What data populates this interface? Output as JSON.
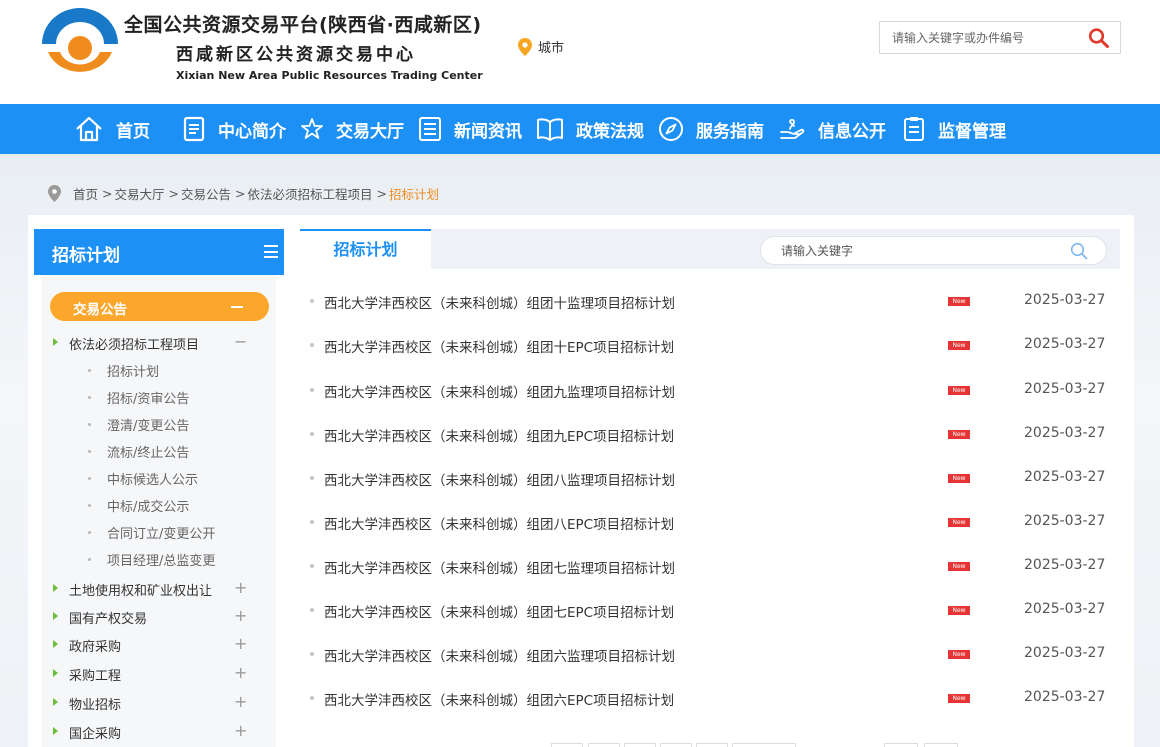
{
  "header": {
    "title_main": "全国公共资源交易平台(陕西省·西咸新区)",
    "title_sub": "西咸新区公共资源交易中心",
    "title_en": "Xixian New Area Public Resources Trading Center",
    "city_label": "城市",
    "search_placeholder": "请输入关键字或办件编号",
    "brand_color": "#1d90f5",
    "accent_color": "#f08c1e"
  },
  "nav": [
    {
      "label": "首页",
      "icon": "home-icon"
    },
    {
      "label": "中心简介",
      "icon": "document-icon"
    },
    {
      "label": "交易大厅",
      "icon": "star-icon"
    },
    {
      "label": "新闻资讯",
      "icon": "list-icon"
    },
    {
      "label": "政策法规",
      "icon": "book-icon"
    },
    {
      "label": "服务指南",
      "icon": "compass-icon"
    },
    {
      "label": "信息公开",
      "icon": "hand-icon"
    },
    {
      "label": "监督管理",
      "icon": "clipboard-icon"
    }
  ],
  "breadcrumb": {
    "items": [
      "首页",
      "交易大厅",
      "交易公告",
      "依法必须招标工程项目"
    ],
    "current": "招标计划"
  },
  "sidebar": {
    "title": "招标计划",
    "category": "交易公告",
    "tree": [
      {
        "label": "依法必须招标工程项目",
        "toggle": "−"
      },
      {
        "label": "土地使用权和矿业权出让",
        "toggle": "+"
      },
      {
        "label": "国有产权交易",
        "toggle": "+"
      },
      {
        "label": "政府采购",
        "toggle": "+"
      },
      {
        "label": "采购工程",
        "toggle": "+"
      },
      {
        "label": "物业招标",
        "toggle": "+"
      },
      {
        "label": "国企采购",
        "toggle": "+"
      }
    ],
    "subitems": [
      "招标计划",
      "招标/资审公告",
      "澄清/变更公告",
      "流标/终止公告",
      "中标候选人公示",
      "中标/成交公示",
      "合同订立/变更公开",
      "项目经理/总监变更"
    ]
  },
  "main": {
    "tab_label": "招标计划",
    "search_placeholder": "请输入关键字",
    "new_badge": "New",
    "rows": [
      {
        "title": "西北大学沣西校区（未来科创城）组团十监理项目招标计划",
        "date": "2025-03-27"
      },
      {
        "title": "西北大学沣西校区（未来科创城）组团十EPC项目招标计划",
        "date": "2025-03-27"
      },
      {
        "title": "西北大学沣西校区（未来科创城）组团九监理项目招标计划",
        "date": "2025-03-27"
      },
      {
        "title": "西北大学沣西校区（未来科创城）组团九EPC项目招标计划",
        "date": "2025-03-27"
      },
      {
        "title": "西北大学沣西校区（未来科创城）组团八监理项目招标计划",
        "date": "2025-03-27"
      },
      {
        "title": "西北大学沣西校区（未来科创城）组团八EPC项目招标计划",
        "date": "2025-03-27"
      },
      {
        "title": "西北大学沣西校区（未来科创城）组团七监理项目招标计划",
        "date": "2025-03-27"
      },
      {
        "title": "西北大学沣西校区（未来科创城）组团七EPC项目招标计划",
        "date": "2025-03-27"
      },
      {
        "title": "西北大学沣西校区（未来科创城）组团六监理项目招标计划",
        "date": "2025-03-27"
      },
      {
        "title": "西北大学沣西校区（未来科创城）组团六EPC项目招标计划",
        "date": "2025-03-27"
      }
    ]
  }
}
